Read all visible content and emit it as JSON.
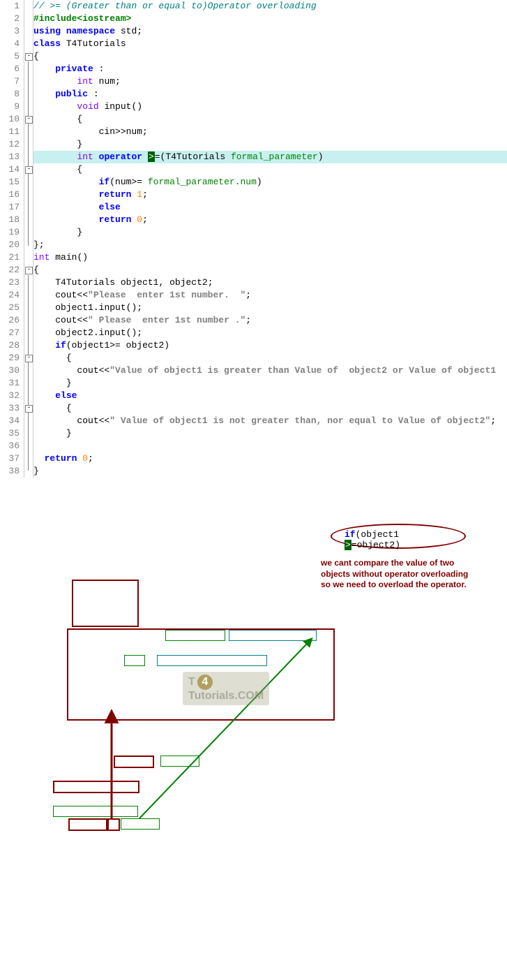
{
  "note": {
    "ellipse_code": "if(object1 >=object2)",
    "note_line1": "we cant compare the value of two",
    "note_line2": "objects without operator overloading",
    "note_line3": "so we need to overload the operator."
  },
  "watermark": {
    "left": "T",
    "mid": "4",
    "right": "Tutorials.COM"
  },
  "lines": {
    "l1": {
      "n": "1",
      "comment": "// >= (Greater than or equal to)Operator overloading"
    },
    "l2": {
      "n": "2",
      "pre": "#include<iostream>"
    },
    "l3": {
      "n": "3",
      "kw1": "using",
      "kw2": "namespace",
      "id": "std",
      "semi": ";"
    },
    "l4": {
      "n": "4",
      "kw": "class",
      "id": "T4Tutorials"
    },
    "l5": {
      "n": "5",
      "brace": "{"
    },
    "l6": {
      "n": "6",
      "kw": "private",
      "colon": ":"
    },
    "l7": {
      "n": "7",
      "type": "int",
      "id": "num",
      "semi": ";"
    },
    "l8": {
      "n": "8",
      "kw": "public",
      "colon": ":"
    },
    "l9": {
      "n": "9",
      "type": "void",
      "fn": "input",
      "paren": "()"
    },
    "l10": {
      "n": "10",
      "brace": "{"
    },
    "l11": {
      "n": "11",
      "stmt": "cin>>num;"
    },
    "l12": {
      "n": "12",
      "brace": "}"
    },
    "l13": {
      "n": "13",
      "type": "int",
      "kw": "operator",
      "op": ">",
      "eq": "=",
      "lp": "(",
      "cls": "T4Tutorials",
      "param": "formal_parameter",
      "rp": ")"
    },
    "l14": {
      "n": "14",
      "brace": "{"
    },
    "l15": {
      "n": "15",
      "kw": "if",
      "lp": "(",
      "id": "num",
      "op": ">=",
      "rhs": "formal_parameter.num",
      "rp": ")"
    },
    "l16": {
      "n": "16",
      "kw": "return",
      "val": "1",
      "semi": ";"
    },
    "l17": {
      "n": "17",
      "kw": "else"
    },
    "l18": {
      "n": "18",
      "kw": "return",
      "val": "0",
      "semi": ";"
    },
    "l19": {
      "n": "19",
      "brace": "}"
    },
    "l20": {
      "n": "20",
      "brace": "};"
    },
    "l21": {
      "n": "21",
      "type": "int",
      "fn": "main",
      "paren": "()"
    },
    "l22": {
      "n": "22",
      "brace": "{"
    },
    "l23": {
      "n": "23",
      "cls": "T4Tutorials",
      "o1": "object1",
      "c": ",",
      "o2": "object2",
      "semi": ";"
    },
    "l24": {
      "n": "24",
      "cout": "cout<<",
      "str": "\"Please  enter 1st number.  \"",
      "semi": ";"
    },
    "l25": {
      "n": "25",
      "o": "object1",
      "dot": ".",
      "fn": "input",
      "paren": "()",
      "semi": ";"
    },
    "l26": {
      "n": "26",
      "cout": "cout<<",
      "str": "\" Please  enter 1st number .\"",
      "semi": ";"
    },
    "l27": {
      "n": "27",
      "o": "object2",
      "dot": ".",
      "fn": "input",
      "paren": "()",
      "semi": ";"
    },
    "l28": {
      "n": "28",
      "kw": "if",
      "lp": "(",
      "o1": "object1",
      "op": ">=",
      "o2": "object2",
      "rp": ")"
    },
    "l29": {
      "n": "29",
      "brace": "{"
    },
    "l30": {
      "n": "30",
      "cout": "cout<<",
      "str": "\"Value of object1 is greater than Value of  object2 or Value of object1"
    },
    "l31": {
      "n": "31",
      "brace": "}"
    },
    "l32": {
      "n": "32",
      "kw": "else"
    },
    "l33": {
      "n": "33",
      "brace": "{"
    },
    "l34": {
      "n": "34",
      "cout": "cout<<",
      "str": "\" Value of object1 is not greater than, nor equal to Value of object2\"",
      "semi": ";"
    },
    "l35": {
      "n": "35",
      "brace": "}"
    },
    "l36": {
      "n": "36"
    },
    "l37": {
      "n": "37",
      "kw": "return",
      "val": "0",
      "semi": ";"
    },
    "l38": {
      "n": "38",
      "brace": "}"
    }
  }
}
